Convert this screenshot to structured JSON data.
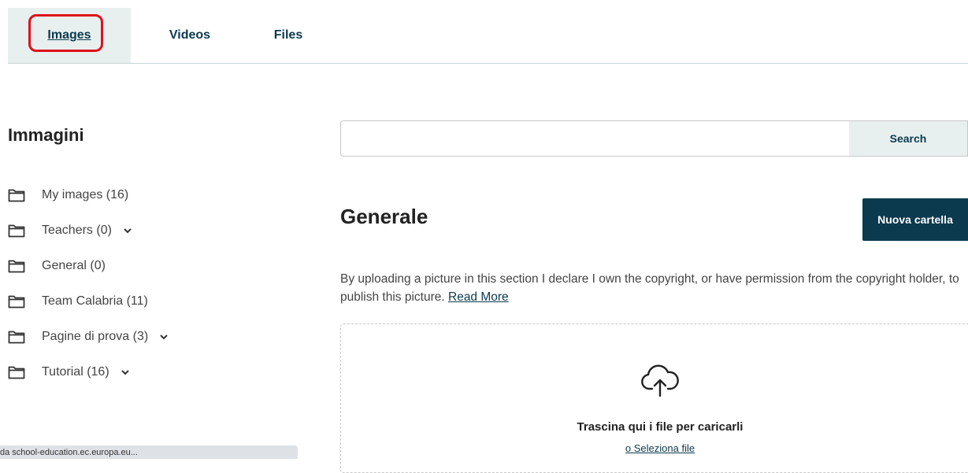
{
  "tabs": [
    {
      "label": "Images",
      "active": true
    },
    {
      "label": "Videos",
      "active": false
    },
    {
      "label": "Files",
      "active": false
    }
  ],
  "sidebar": {
    "title": "Immagini",
    "folders": [
      {
        "label": "My images (16)",
        "expandable": false
      },
      {
        "label": "Teachers (0)",
        "expandable": true
      },
      {
        "label": "General (0)",
        "expandable": false
      },
      {
        "label": "Team Calabria (11)",
        "expandable": false
      },
      {
        "label": "Pagine di prova (3)",
        "expandable": true
      },
      {
        "label": "Tutorial (16)",
        "expandable": true
      }
    ]
  },
  "search": {
    "value": "",
    "placeholder": "",
    "button_label": "Search"
  },
  "main": {
    "title": "Generale",
    "new_folder_label": "Nuova cartella",
    "disclaimer_text": "By uploading a picture in this section I declare I own the copyright, or have permission from the copyright holder, to publish this picture.",
    "read_more_label": "Read More"
  },
  "dropzone": {
    "icon": "cloud-upload-icon",
    "text": "Trascina qui i file per caricarli",
    "select_label": "o Seleziona file"
  },
  "statusbar": {
    "text": "da school-education.ec.europa.eu..."
  },
  "colors": {
    "accent": "#0b3a4e",
    "tab_active_bg": "#e8f0ef",
    "highlight": "#e0101c"
  }
}
